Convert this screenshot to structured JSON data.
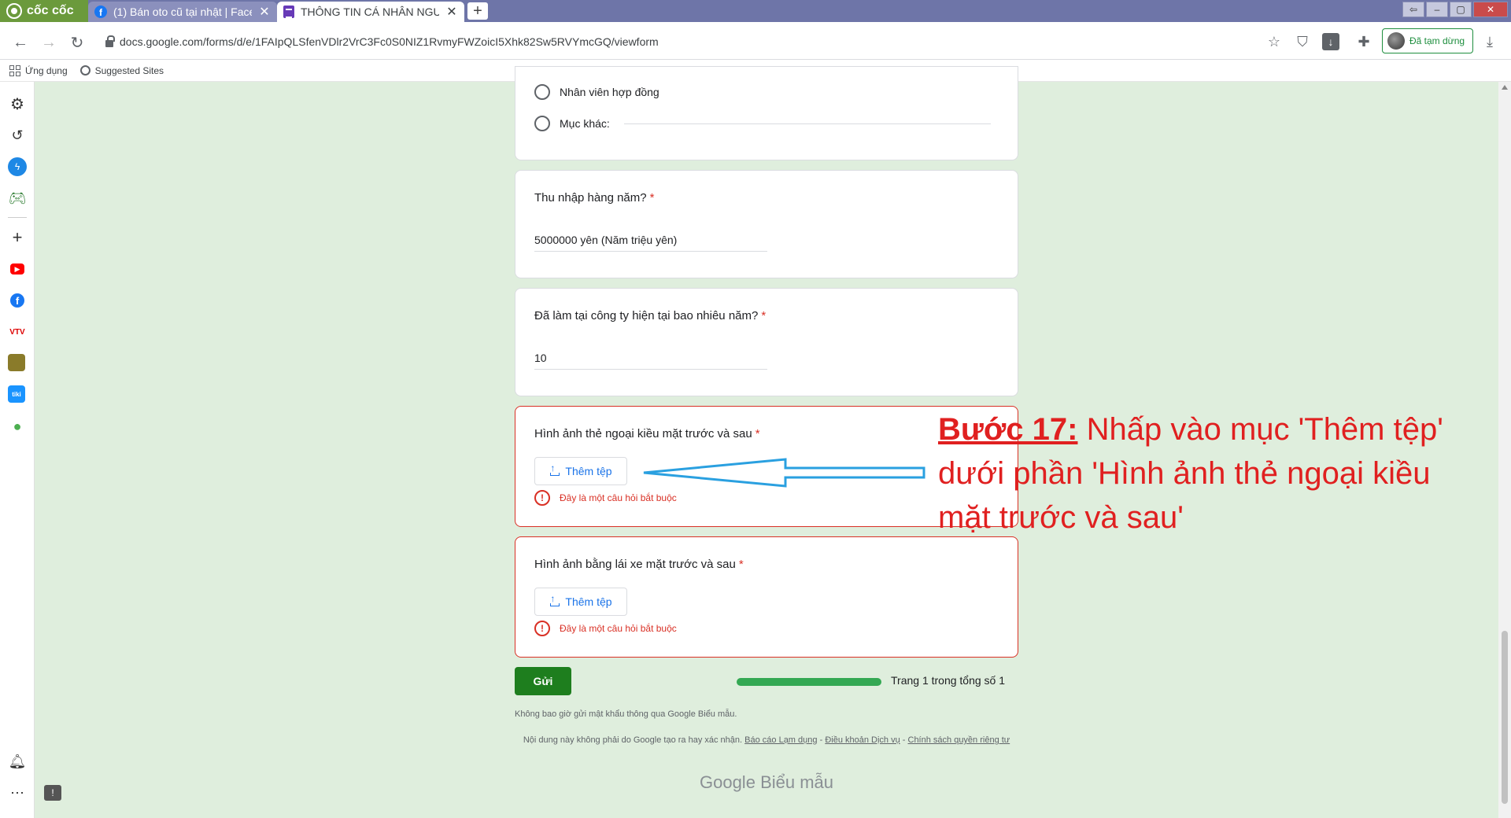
{
  "browser": {
    "brand": "cốc cốc",
    "tabs": [
      {
        "title": "(1) Bán oto cũ tại nhật | Faceb",
        "icon": "facebook-icon"
      },
      {
        "title": "THÔNG TIN CÁ NHÂN NGƯỜ",
        "icon": "google-forms-icon"
      }
    ],
    "url": "docs.google.com/forms/d/e/1FAIpQLSfenVDlr2VrC3Fc0S0NIZ1RvmyFWZoicI5Xhk82Sw5RVYmcGQ/viewform",
    "paused_label": "Đã tạm dừng",
    "bookmarks": [
      "Ứng dụng",
      "Suggested Sites"
    ]
  },
  "form": {
    "options": [
      "Nhân viên hợp đồng",
      "Mục khác:"
    ],
    "q_income": {
      "title": "Thu nhập hàng năm?",
      "answer": "5000000 yên (Năm triệu yên)"
    },
    "q_years": {
      "title": "Đã làm tại công ty hiện tại bao nhiêu năm?",
      "answer": "10"
    },
    "q_residence_card": {
      "title": "Hình ảnh thẻ ngoại kiều mặt trước và sau",
      "button": "Thêm tệp",
      "error": "Đây là một câu hỏi bắt buộc"
    },
    "q_license": {
      "title": "Hình ảnh bằng lái xe mặt trước và sau",
      "button": "Thêm tệp",
      "error": "Đây là một câu hỏi bắt buộc"
    },
    "required_mark": "*",
    "submit_label": "Gửi",
    "page_indicator": "Trang 1 trong tổng số 1",
    "progress": 1.0,
    "no_password": "Không bao giờ gửi mật khẩu thông qua Google Biểu mẫu.",
    "disclaimer_prefix": "Nội dung này không phải do Google tạo ra hay xác nhận.",
    "links": [
      "Báo cáo Lạm dụng",
      "Điều khoản Dịch vụ",
      "Chính sách quyền riêng tư"
    ],
    "separator": "-",
    "logo_google": "Google",
    "logo_forms": "Biểu mẫu"
  },
  "annotation": {
    "step": "Bước 17:",
    "text": "Nhấp vào mục 'Thêm tệp' dưới phần 'Hình ảnh thẻ ngoại kiều mặt trước và sau'",
    "color": "#e02020"
  }
}
